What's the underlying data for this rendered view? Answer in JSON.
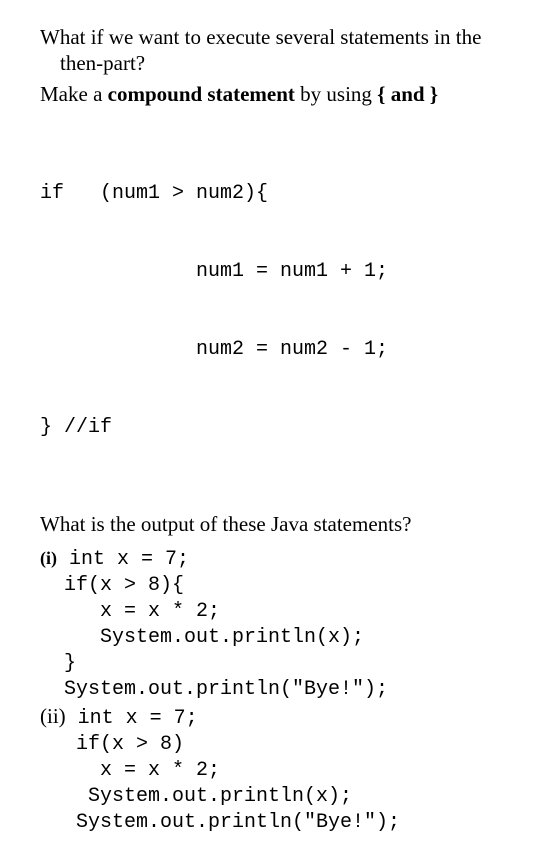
{
  "intro": {
    "line1": "What if we want to execute several statements in the then-part?",
    "line2_pre": "Make a ",
    "line2_bold": "compound statement",
    "line2_post": " by using ",
    "brace_open": "{",
    "line2_and": " and ",
    "brace_close": "}"
  },
  "code1": {
    "l1": "if   (num1 > num2){",
    "l2": "             num1 = num1 + 1;",
    "l3": "             num2 = num2 - 1;",
    "l4": "} //if"
  },
  "question": "What is the output of these Java statements?",
  "part_i": {
    "label": "(i)",
    "l1": " int x = 7;",
    "l2": "  if(x > 8){",
    "l3": "     x = x * 2;",
    "l4": "     System.out.println(x);",
    "l5": "  }",
    "l6": "  System.out.println(\"Bye!\");"
  },
  "part_ii": {
    "label": "(ii)",
    "l1": " int x = 7;",
    "l2": "   if(x > 8)",
    "l3": "     x = x * 2;",
    "l4": "    System.out.println(x);",
    "l5": "   System.out.println(\"Bye!\");"
  }
}
